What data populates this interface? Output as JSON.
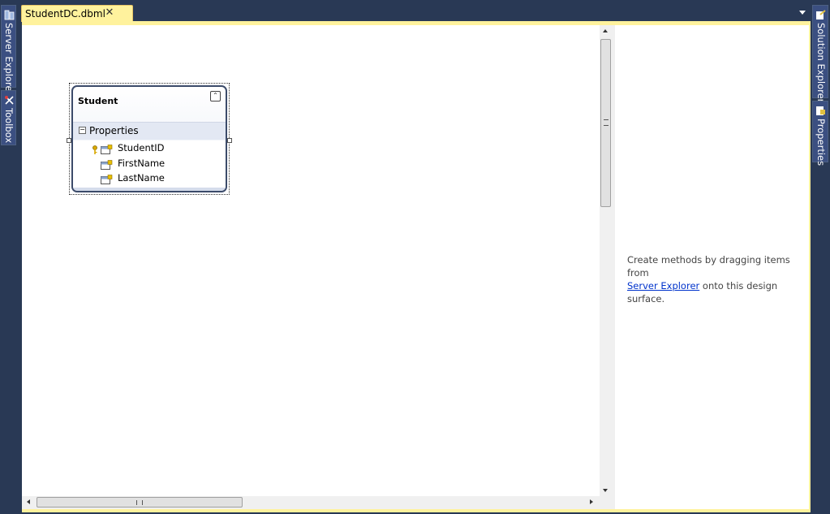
{
  "document_tab": {
    "label": "StudentDC.dbml",
    "close_icon": "close-icon"
  },
  "left_panels": [
    {
      "label": "Server Explorer",
      "icon": "server-explorer-icon"
    },
    {
      "label": "Toolbox",
      "icon": "toolbox-icon"
    }
  ],
  "right_panels": [
    {
      "label": "Solution Explorer",
      "icon": "solution-explorer-icon"
    },
    {
      "label": "Properties",
      "icon": "properties-icon"
    }
  ],
  "entity": {
    "name": "Student",
    "section": "Properties",
    "properties": [
      {
        "name": "StudentID",
        "is_key": true
      },
      {
        "name": "FirstName",
        "is_key": false
      },
      {
        "name": "LastName",
        "is_key": false
      }
    ]
  },
  "methods_pane": {
    "text_before": "Create methods by dragging items from",
    "link_text": "Server Explorer",
    "text_after": "onto this design surface."
  },
  "colors": {
    "frame_background": "#293955",
    "active_tab": "#fff29d",
    "link": "#0033cc"
  }
}
